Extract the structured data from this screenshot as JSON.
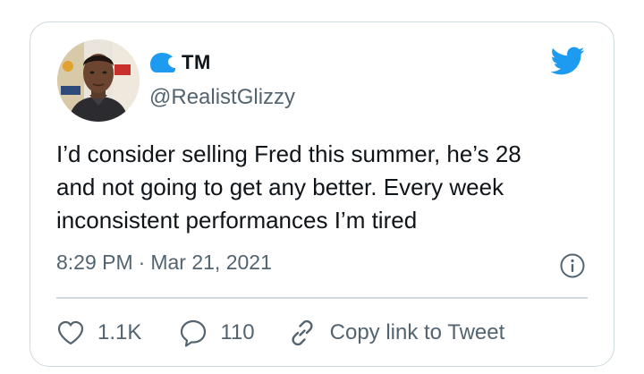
{
  "tweet": {
    "display_name": "TM",
    "handle": "@RealistGlizzy",
    "text_lines": [
      "I’d consider selling Fred this summer, he’s 28",
      "and not going to get any better. Every week",
      "inconsistent performances I’m tired"
    ],
    "time": "8:29 PM",
    "separator": "·",
    "date": "Mar 21, 2021"
  },
  "actions": {
    "like_count": "1.1K",
    "reply_count": "110",
    "copy_link_label": "Copy link to Tweet"
  },
  "icons": {
    "brand": "twitter-bird-icon",
    "like": "heart-icon",
    "reply": "speech-bubble-icon",
    "copy": "link-icon",
    "info": "info-icon",
    "name_prefix": "wave-icon"
  },
  "colors": {
    "twitter_blue": "#1d9bf0",
    "text": "#0f1419",
    "secondary_text": "#536471",
    "border": "#cfd9de"
  }
}
